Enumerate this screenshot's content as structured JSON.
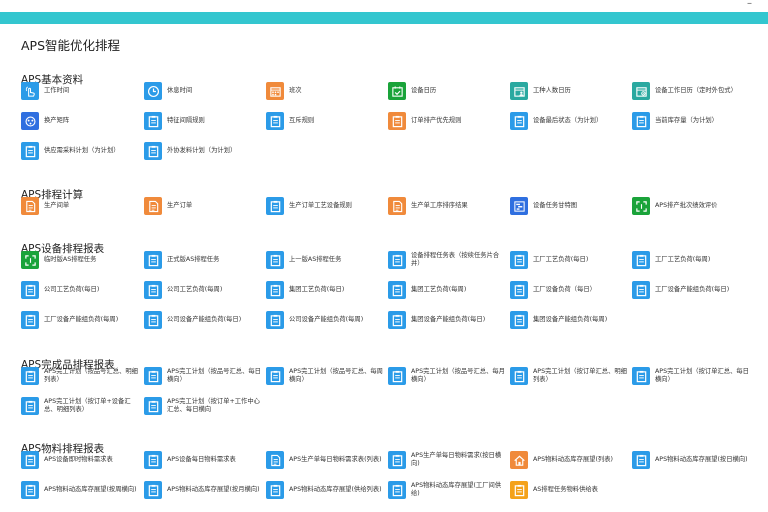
{
  "window": {
    "minimize_label": "–"
  },
  "page_title": "APS智能优化排程",
  "colors": {
    "accent_bar": "#33c6cf",
    "blue": "#2b9be8",
    "orange": "#f08a3b",
    "green": "#1aa33a",
    "teal": "#2aa9a0",
    "indigo": "#2f6fe0"
  },
  "sections": [
    {
      "title": "APS基本资料",
      "items": [
        {
          "label": "工作时间",
          "icon": "hand-pointer-icon",
          "color": "#2b9be8"
        },
        {
          "label": "休息时间",
          "icon": "clock-icon",
          "color": "#2b9be8"
        },
        {
          "label": "班次",
          "icon": "calendar-grid-icon",
          "color": "#f08a3b"
        },
        {
          "label": "设备日历",
          "icon": "calendar-check-icon",
          "color": "#1aa33a"
        },
        {
          "label": "工种人数日历",
          "icon": "calendar-user-icon",
          "color": "#2aa9a0"
        },
        {
          "label": "设备工作日历（定时外包式）",
          "icon": "calendar-gear-icon",
          "color": "#2aa9a0"
        },
        {
          "label": "换产矩阵",
          "icon": "matrix-icon",
          "color": "#2f6fe0"
        },
        {
          "label": "特征间隔规则",
          "icon": "clipboard-icon",
          "color": "#2b9be8"
        },
        {
          "label": "互斥规则",
          "icon": "clipboard-icon",
          "color": "#2b9be8"
        },
        {
          "label": "订单排产优先规则",
          "icon": "clipboard-icon",
          "color": "#f08a3b"
        },
        {
          "label": "设备最后状态（为计划）",
          "icon": "clipboard-icon",
          "color": "#2b9be8"
        },
        {
          "label": "当前库存量（为计划）",
          "icon": "clipboard-icon",
          "color": "#2b9be8"
        },
        {
          "label": "供应需采料计划（为计划）",
          "icon": "clipboard-icon",
          "color": "#2b9be8"
        },
        {
          "label": "外协发料计划（为计划）",
          "icon": "clipboard-icon",
          "color": "#2b9be8"
        }
      ]
    },
    {
      "title": "APS排程计算",
      "items": [
        {
          "label": "生产间单",
          "icon": "document-icon",
          "color": "#f08a3b"
        },
        {
          "label": "生产订单",
          "icon": "document-icon",
          "color": "#f08a3b"
        },
        {
          "label": "生产订单工艺设备规则",
          "icon": "clipboard-icon",
          "color": "#2b9be8"
        },
        {
          "label": "生产单工序排序结果",
          "icon": "document-icon",
          "color": "#f08a3b"
        },
        {
          "label": "设备任务甘特图",
          "icon": "gantt-icon",
          "color": "#2f6fe0"
        },
        {
          "label": "APS排产批次绩效评价",
          "icon": "frame-icon",
          "color": "#1aa33a"
        }
      ]
    },
    {
      "title": "APS设备排程报表",
      "items": [
        {
          "label": "临时版AS排程任务",
          "icon": "frame-icon",
          "color": "#1aa33a"
        },
        {
          "label": "正式版AS排程任务",
          "icon": "clipboard-icon",
          "color": "#2b9be8"
        },
        {
          "label": "上一版AS排程任务",
          "icon": "clipboard-icon",
          "color": "#2b9be8"
        },
        {
          "label": "设备排程任务表（按续任务片合并）",
          "icon": "clipboard-icon",
          "color": "#2b9be8"
        },
        {
          "label": "工厂工艺负荷(每日)",
          "icon": "clipboard-icon",
          "color": "#2b9be8"
        },
        {
          "label": "工厂工艺负荷(每周)",
          "icon": "clipboard-icon",
          "color": "#2b9be8"
        },
        {
          "label": "公司工艺负荷(每日)",
          "icon": "clipboard-icon",
          "color": "#2b9be8"
        },
        {
          "label": "公司工艺负荷(每周)",
          "icon": "clipboard-icon",
          "color": "#2b9be8"
        },
        {
          "label": "集团工艺负荷(每日)",
          "icon": "clipboard-icon",
          "color": "#2b9be8"
        },
        {
          "label": "集团工艺负荷(每周)",
          "icon": "clipboard-icon",
          "color": "#2b9be8"
        },
        {
          "label": "工厂设备负荷（每日）",
          "icon": "clipboard-icon",
          "color": "#2b9be8"
        },
        {
          "label": "工厂设备产能组负荷(每日)",
          "icon": "clipboard-icon",
          "color": "#2b9be8"
        },
        {
          "label": "工厂设备产能组负荷(每周)",
          "icon": "clipboard-icon",
          "color": "#2b9be8"
        },
        {
          "label": "公司设备产能组负荷(每日)",
          "icon": "clipboard-icon",
          "color": "#2b9be8"
        },
        {
          "label": "公司设备产能组负荷(每周)",
          "icon": "clipboard-icon",
          "color": "#2b9be8"
        },
        {
          "label": "集团设备产能组负荷(每日)",
          "icon": "clipboard-icon",
          "color": "#2b9be8"
        },
        {
          "label": "集团设备产能组负荷(每周)",
          "icon": "clipboard-icon",
          "color": "#2b9be8"
        }
      ]
    },
    {
      "title": "APS完成品排程报表",
      "items": [
        {
          "label": "APS完工计划（按品号汇总、明细列表）",
          "icon": "clipboard-icon",
          "color": "#2b9be8"
        },
        {
          "label": "APS完工计划（按品号汇总、每日横向）",
          "icon": "clipboard-icon",
          "color": "#2b9be8"
        },
        {
          "label": "APS完工计划（按品号汇总、每周横向）",
          "icon": "clipboard-icon",
          "color": "#2b9be8"
        },
        {
          "label": "APS完工计划（按品号汇总、每月横向）",
          "icon": "clipboard-icon",
          "color": "#2b9be8"
        },
        {
          "label": "APS完工计划（按订单汇总、明细列表）",
          "icon": "clipboard-icon",
          "color": "#2b9be8"
        },
        {
          "label": "APS完工计划（按订单汇总、每日横向）",
          "icon": "clipboard-icon",
          "color": "#2b9be8"
        },
        {
          "label": "APS完工计划（按订单+设备汇总、明细列表）",
          "icon": "clipboard-icon",
          "color": "#2b9be8"
        },
        {
          "label": "APS完工计划（按订单+工作中心汇总、每日横向",
          "icon": "clipboard-icon",
          "color": "#2b9be8"
        }
      ]
    },
    {
      "title": "APS物料排程报表",
      "items": [
        {
          "label": "APS设备即时物料需求表",
          "icon": "clipboard-icon",
          "color": "#2b9be8"
        },
        {
          "label": "APS设备每日物料需求表",
          "icon": "clipboard-icon",
          "color": "#2b9be8"
        },
        {
          "label": "APS生产单每日物料需求表(列表)",
          "icon": "document-icon",
          "color": "#2b9be8"
        },
        {
          "label": "APS生产单每日物料需求(按日横向)",
          "icon": "clipboard-icon",
          "color": "#2b9be8"
        },
        {
          "label": "APS物料动态库存展望(列表)",
          "icon": "house-icon",
          "color": "#f08a3b"
        },
        {
          "label": "APS物料动态库存展望(按日横向)",
          "icon": "clipboard-icon",
          "color": "#2b9be8"
        },
        {
          "label": "APS物料动态库存展望(按周横向)",
          "icon": "clipboard-icon",
          "color": "#2b9be8"
        },
        {
          "label": "APS物料动态库存展望(按月横向)",
          "icon": "clipboard-icon",
          "color": "#2b9be8"
        },
        {
          "label": "APS物料动态库存展望(供给列表)",
          "icon": "clipboard-icon",
          "color": "#2b9be8"
        },
        {
          "label": "APS物料动态库存展望(工厂间供给)",
          "icon": "clipboard-icon",
          "color": "#2b9be8"
        },
        {
          "label": "AS排程任务物料供给表",
          "icon": "clipboard-icon",
          "color": "#f4a21a"
        }
      ]
    }
  ]
}
